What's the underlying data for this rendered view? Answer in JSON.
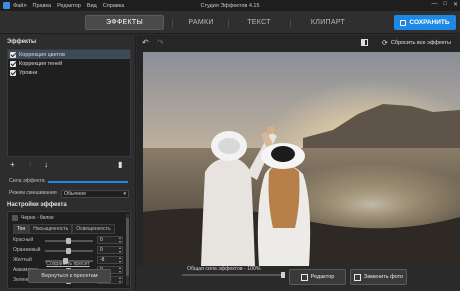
{
  "window": {
    "title": "Студия Эффектов 4.15",
    "menu": [
      "Файл",
      "Правка",
      "Редактор",
      "Вид",
      "Справка"
    ],
    "controls": [
      "—",
      "□",
      "✕"
    ]
  },
  "tabs": [
    {
      "label": "ЭФФЕКТЫ",
      "active": true
    },
    {
      "label": "РАМКИ",
      "active": false
    },
    {
      "label": "ТЕКСТ",
      "active": false
    },
    {
      "label": "КЛИПАРТ",
      "active": false
    }
  ],
  "save_button": "СОХРАНИТЬ",
  "left_panel": {
    "effects_title": "Эффекты",
    "effects": [
      {
        "label": "Коррекция цветов",
        "checked": true,
        "selected": true
      },
      {
        "label": "Коррекция теней",
        "checked": true,
        "selected": false
      },
      {
        "label": "Уровни",
        "checked": true,
        "selected": false
      }
    ],
    "strength_label": "Сила эффекта",
    "blend_label": "Режим смешивания",
    "blend_value": "Обычное",
    "settings_title": "Настройки эффекта",
    "bw_label": "Черно - белое",
    "bw_checked": false,
    "subtabs": [
      {
        "label": "Тон",
        "active": true
      },
      {
        "label": "Насыщенность",
        "active": false
      },
      {
        "label": "Освещенность",
        "active": false
      }
    ],
    "params": [
      {
        "label": "Красный",
        "value": "0"
      },
      {
        "label": "Оранжевый",
        "value": "0"
      },
      {
        "label": "Желтый",
        "value": "-8"
      },
      {
        "label": "Аквамарин",
        "value": "0"
      },
      {
        "label": "Зеленый",
        "value": "0"
      }
    ],
    "save_preset": "Сохранить пресет",
    "back_button": "Вернуться к пресетам"
  },
  "canvas": {
    "reset_label": "Сбросить все эффекты",
    "overall_strength_label": "Общая сила эффектов - 100%",
    "overall_strength": 1.0,
    "editor_button": "Редактор",
    "replace_button": "Заменить фото"
  }
}
